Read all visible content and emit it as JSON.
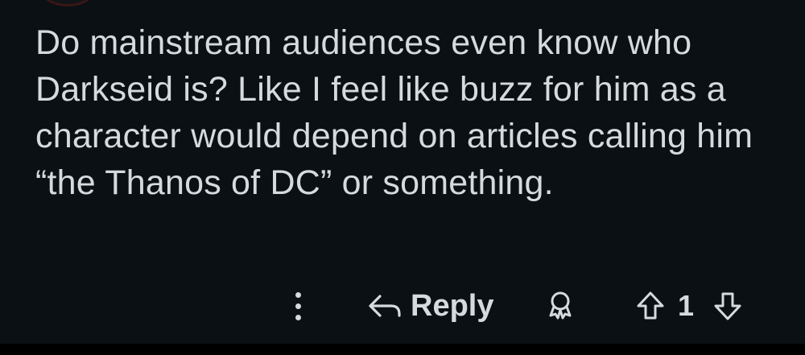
{
  "comment": {
    "body": "Do mainstream audiences even know who Darkseid is? Like I feel like buzz for him as a character would depend on articles calling him “the Thanos of DC” or something."
  },
  "actions": {
    "more_icon": "vertical-ellipsis",
    "reply_icon": "reply-arrow",
    "reply_label": "Reply",
    "award_icon": "award-ribbon",
    "upvote_icon": "arrow-up-outline",
    "vote_count": "1",
    "downvote_icon": "arrow-down-outline"
  },
  "colors": {
    "background": "#0b1014",
    "text": "#d7dadc"
  }
}
